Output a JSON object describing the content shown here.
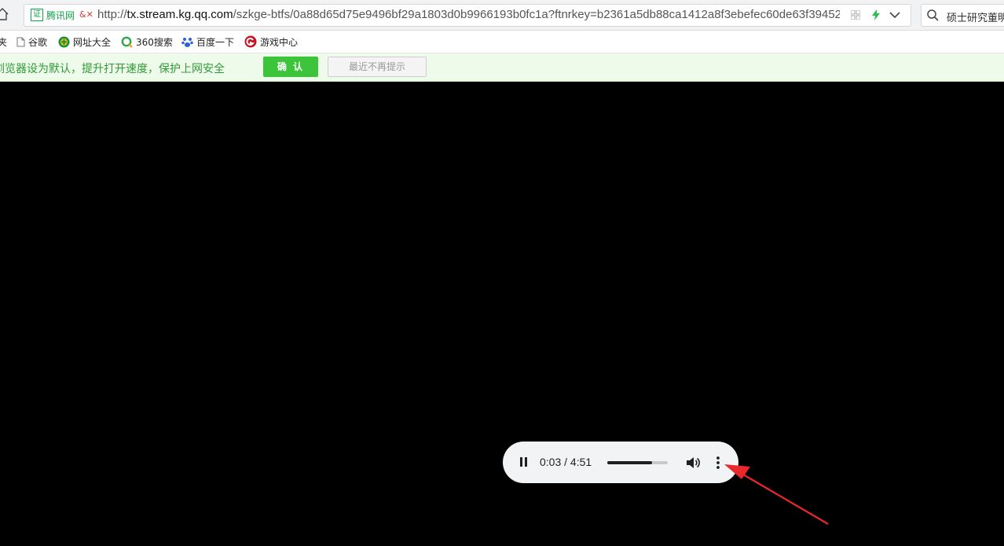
{
  "address_bar": {
    "cert_badge_label": "证",
    "cert_name": "腾讯网",
    "cert_warning": "&✕",
    "url_prefix": "http://",
    "url_domain": "tx.stream.kg.qq.com",
    "url_path": "/szkge-btfs/0a88d65d75e9496bf29a1803d0b9966193b0fc1a?ftnrkey=b2361a5db88ca1412a8f3ebefec60de63f39452"
  },
  "search": {
    "text": "硕士研究董明"
  },
  "bookmarks": [
    {
      "label": "夹",
      "icon": "folder-icon"
    },
    {
      "label": "谷歌",
      "icon": "page-icon"
    },
    {
      "label": "网址大全",
      "icon": "hao123-icon"
    },
    {
      "label": "360搜索",
      "icon": "360-search-icon"
    },
    {
      "label": "百度一下",
      "icon": "baidu-paw-icon"
    },
    {
      "label": "游戏中心",
      "icon": "game-center-icon"
    }
  ],
  "notification": {
    "text": "浏览器设为默认，提升打开速度，保护上网安全",
    "confirm_label": "确 认",
    "dismiss_label": "最近不再提示"
  },
  "player": {
    "time": "0:03 / 4:51",
    "buffered_fraction": 0.74
  },
  "colors": {
    "accent_green": "#3cc43a",
    "notify_text": "#2f9b36",
    "annotation_arrow": "#e8282b"
  }
}
